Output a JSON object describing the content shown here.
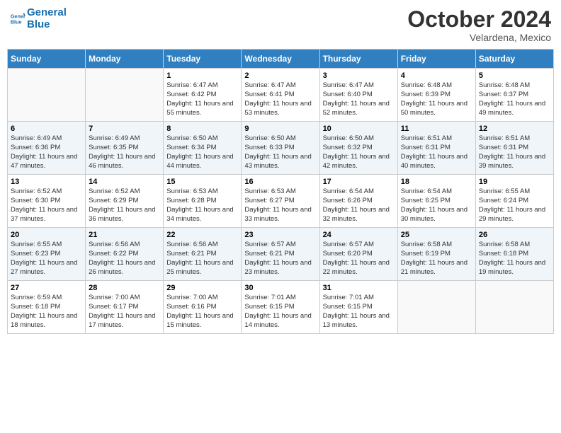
{
  "header": {
    "logo_line1": "General",
    "logo_line2": "Blue",
    "month": "October 2024",
    "location": "Velardena, Mexico"
  },
  "weekdays": [
    "Sunday",
    "Monday",
    "Tuesday",
    "Wednesday",
    "Thursday",
    "Friday",
    "Saturday"
  ],
  "weeks": [
    [
      {
        "day": "",
        "info": ""
      },
      {
        "day": "",
        "info": ""
      },
      {
        "day": "1",
        "info": "Sunrise: 6:47 AM\nSunset: 6:42 PM\nDaylight: 11 hours and 55 minutes."
      },
      {
        "day": "2",
        "info": "Sunrise: 6:47 AM\nSunset: 6:41 PM\nDaylight: 11 hours and 53 minutes."
      },
      {
        "day": "3",
        "info": "Sunrise: 6:47 AM\nSunset: 6:40 PM\nDaylight: 11 hours and 52 minutes."
      },
      {
        "day": "4",
        "info": "Sunrise: 6:48 AM\nSunset: 6:39 PM\nDaylight: 11 hours and 50 minutes."
      },
      {
        "day": "5",
        "info": "Sunrise: 6:48 AM\nSunset: 6:37 PM\nDaylight: 11 hours and 49 minutes."
      }
    ],
    [
      {
        "day": "6",
        "info": "Sunrise: 6:49 AM\nSunset: 6:36 PM\nDaylight: 11 hours and 47 minutes."
      },
      {
        "day": "7",
        "info": "Sunrise: 6:49 AM\nSunset: 6:35 PM\nDaylight: 11 hours and 46 minutes."
      },
      {
        "day": "8",
        "info": "Sunrise: 6:50 AM\nSunset: 6:34 PM\nDaylight: 11 hours and 44 minutes."
      },
      {
        "day": "9",
        "info": "Sunrise: 6:50 AM\nSunset: 6:33 PM\nDaylight: 11 hours and 43 minutes."
      },
      {
        "day": "10",
        "info": "Sunrise: 6:50 AM\nSunset: 6:32 PM\nDaylight: 11 hours and 42 minutes."
      },
      {
        "day": "11",
        "info": "Sunrise: 6:51 AM\nSunset: 6:31 PM\nDaylight: 11 hours and 40 minutes."
      },
      {
        "day": "12",
        "info": "Sunrise: 6:51 AM\nSunset: 6:31 PM\nDaylight: 11 hours and 39 minutes."
      }
    ],
    [
      {
        "day": "13",
        "info": "Sunrise: 6:52 AM\nSunset: 6:30 PM\nDaylight: 11 hours and 37 minutes."
      },
      {
        "day": "14",
        "info": "Sunrise: 6:52 AM\nSunset: 6:29 PM\nDaylight: 11 hours and 36 minutes."
      },
      {
        "day": "15",
        "info": "Sunrise: 6:53 AM\nSunset: 6:28 PM\nDaylight: 11 hours and 34 minutes."
      },
      {
        "day": "16",
        "info": "Sunrise: 6:53 AM\nSunset: 6:27 PM\nDaylight: 11 hours and 33 minutes."
      },
      {
        "day": "17",
        "info": "Sunrise: 6:54 AM\nSunset: 6:26 PM\nDaylight: 11 hours and 32 minutes."
      },
      {
        "day": "18",
        "info": "Sunrise: 6:54 AM\nSunset: 6:25 PM\nDaylight: 11 hours and 30 minutes."
      },
      {
        "day": "19",
        "info": "Sunrise: 6:55 AM\nSunset: 6:24 PM\nDaylight: 11 hours and 29 minutes."
      }
    ],
    [
      {
        "day": "20",
        "info": "Sunrise: 6:55 AM\nSunset: 6:23 PM\nDaylight: 11 hours and 27 minutes."
      },
      {
        "day": "21",
        "info": "Sunrise: 6:56 AM\nSunset: 6:22 PM\nDaylight: 11 hours and 26 minutes."
      },
      {
        "day": "22",
        "info": "Sunrise: 6:56 AM\nSunset: 6:21 PM\nDaylight: 11 hours and 25 minutes."
      },
      {
        "day": "23",
        "info": "Sunrise: 6:57 AM\nSunset: 6:21 PM\nDaylight: 11 hours and 23 minutes."
      },
      {
        "day": "24",
        "info": "Sunrise: 6:57 AM\nSunset: 6:20 PM\nDaylight: 11 hours and 22 minutes."
      },
      {
        "day": "25",
        "info": "Sunrise: 6:58 AM\nSunset: 6:19 PM\nDaylight: 11 hours and 21 minutes."
      },
      {
        "day": "26",
        "info": "Sunrise: 6:58 AM\nSunset: 6:18 PM\nDaylight: 11 hours and 19 minutes."
      }
    ],
    [
      {
        "day": "27",
        "info": "Sunrise: 6:59 AM\nSunset: 6:18 PM\nDaylight: 11 hours and 18 minutes."
      },
      {
        "day": "28",
        "info": "Sunrise: 7:00 AM\nSunset: 6:17 PM\nDaylight: 11 hours and 17 minutes."
      },
      {
        "day": "29",
        "info": "Sunrise: 7:00 AM\nSunset: 6:16 PM\nDaylight: 11 hours and 15 minutes."
      },
      {
        "day": "30",
        "info": "Sunrise: 7:01 AM\nSunset: 6:15 PM\nDaylight: 11 hours and 14 minutes."
      },
      {
        "day": "31",
        "info": "Sunrise: 7:01 AM\nSunset: 6:15 PM\nDaylight: 11 hours and 13 minutes."
      },
      {
        "day": "",
        "info": ""
      },
      {
        "day": "",
        "info": ""
      }
    ]
  ]
}
